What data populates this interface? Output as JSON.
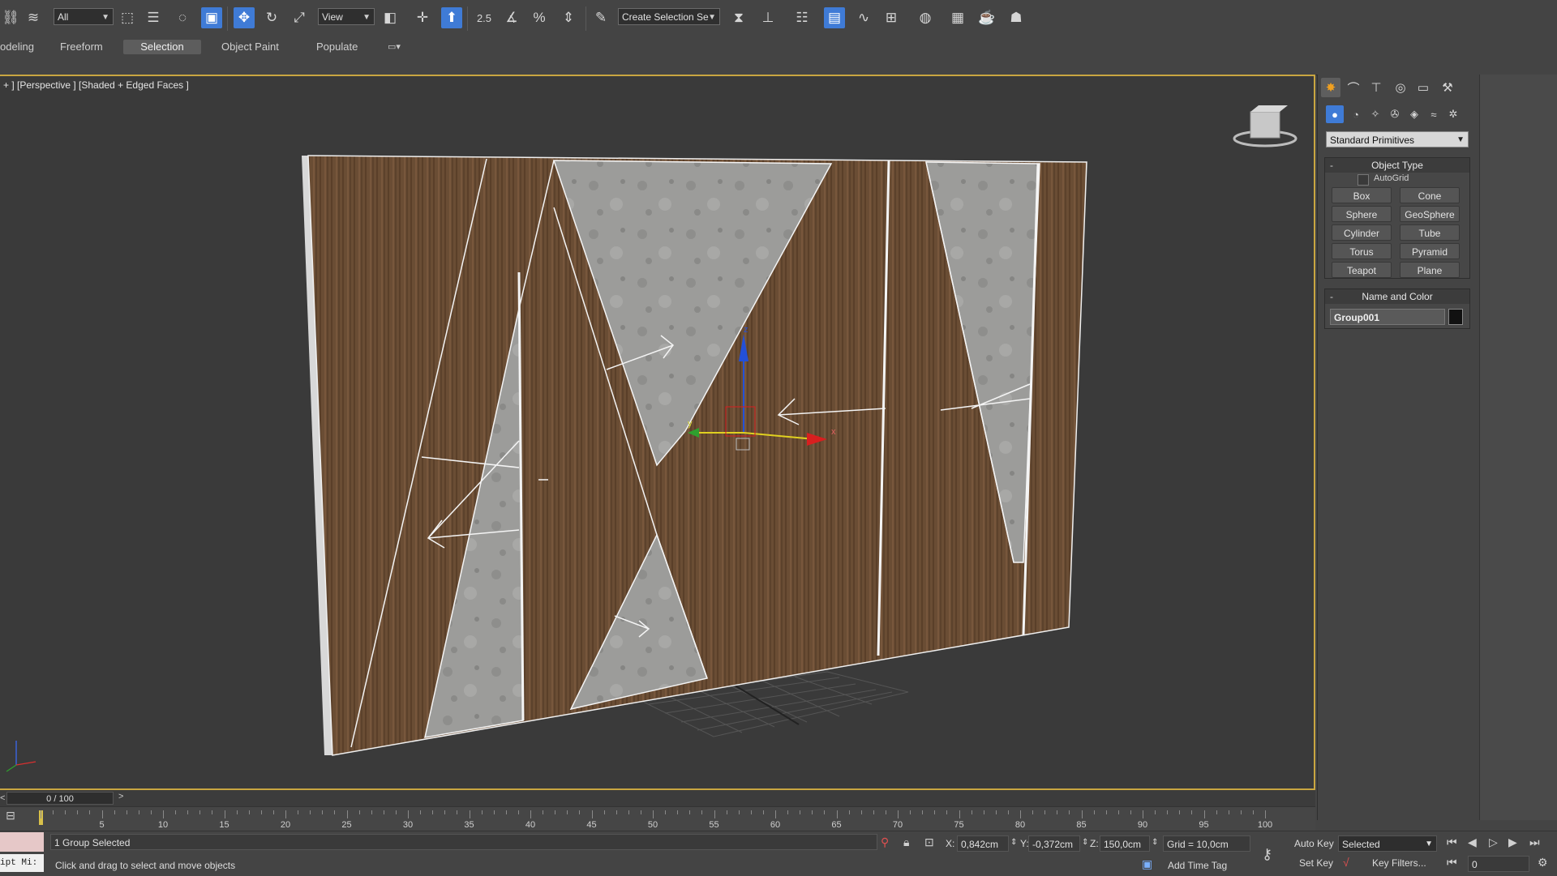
{
  "toolbar": {
    "selection_filter": "All",
    "ref_coord": "View",
    "named_selection_placeholder": "Create Selection Se",
    "snap_label": "2.5",
    "percent_label": "%"
  },
  "ribbon": {
    "tabs": [
      "odeling",
      "Freeform",
      "Selection",
      "Object Paint",
      "Populate"
    ]
  },
  "viewport": {
    "label": "+ ] [Perspective ] [Shaded + Edged Faces ]",
    "axis_labels": {
      "x": "x",
      "y": "y",
      "z": "z"
    }
  },
  "command_panel": {
    "category_dropdown": "Standard Primitives",
    "object_type": {
      "title": "Object Type",
      "autogrid_label": "AutoGrid",
      "buttons": [
        "Box",
        "Cone",
        "Sphere",
        "GeoSphere",
        "Cylinder",
        "Tube",
        "Torus",
        "Pyramid",
        "Teapot",
        "Plane"
      ]
    },
    "name_and_color": {
      "title": "Name and Color",
      "object_name": "Group001",
      "color": "#111111"
    }
  },
  "timeline": {
    "frame_display": "0 / 100",
    "next_label": ">",
    "ticks": [
      "5",
      "10",
      "15",
      "20",
      "25",
      "30",
      "35",
      "40",
      "45",
      "50",
      "55",
      "60",
      "65",
      "70",
      "75",
      "80",
      "85",
      "90",
      "95",
      "100"
    ]
  },
  "status": {
    "script_label": "ipt Mi:",
    "selection_info": "1 Group Selected",
    "prompt": "Click and drag to select and move objects",
    "x_label": "X:",
    "x_value": "0,842cm",
    "y_label": "Y:",
    "y_value": "-0,372cm",
    "z_label": "Z:",
    "z_value": "150,0cm",
    "grid": "Grid = 10,0cm",
    "add_time_tag": "Add Time Tag",
    "auto_key": "Auto Key",
    "set_key": "Set Key",
    "key_mode": "Selected",
    "key_filters": "Key Filters...",
    "current_frame": "0"
  },
  "colors": {
    "viewport_border": "#c9a641",
    "active_blue": "#3f7bd6",
    "wood": "#6e5138",
    "concrete": "#9a9a98"
  }
}
